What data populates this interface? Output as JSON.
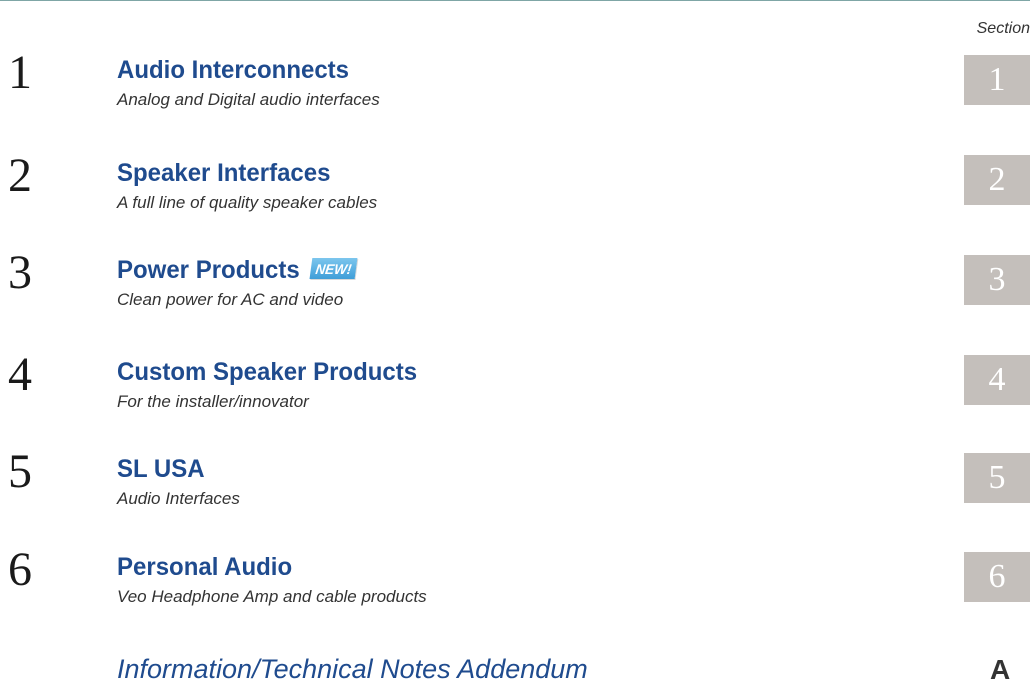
{
  "header": {
    "section_label": "Section"
  },
  "entries": [
    {
      "number": "1",
      "title": "Audio Interconnects",
      "subtitle": "Analog and Digital audio interfaces",
      "tab": "1"
    },
    {
      "number": "2",
      "title": "Speaker Interfaces",
      "subtitle": "A full line of quality speaker cables",
      "tab": "2"
    },
    {
      "number": "3",
      "title": "Power Products",
      "badge": "NEW!",
      "subtitle": "Clean power for AC and video",
      "tab": "3"
    },
    {
      "number": "4",
      "title": "Custom Speaker Products",
      "subtitle": "For the installer/innovator",
      "tab": "4"
    },
    {
      "number": "5",
      "title": "SL USA",
      "subtitle": "Audio Interfaces",
      "tab": "5"
    },
    {
      "number": "6",
      "title": "Personal Audio",
      "subtitle": "Veo Headphone Amp and cable products",
      "tab": "6"
    }
  ],
  "addendum": {
    "title": "Information/Technical Notes Addendum",
    "tab": "A"
  },
  "colors": {
    "title_blue": "#1f4b8e",
    "tab_gray": "#c4bfbb",
    "rule_teal": "#7fa6a6",
    "badge_blue": "#3f9ed8"
  }
}
